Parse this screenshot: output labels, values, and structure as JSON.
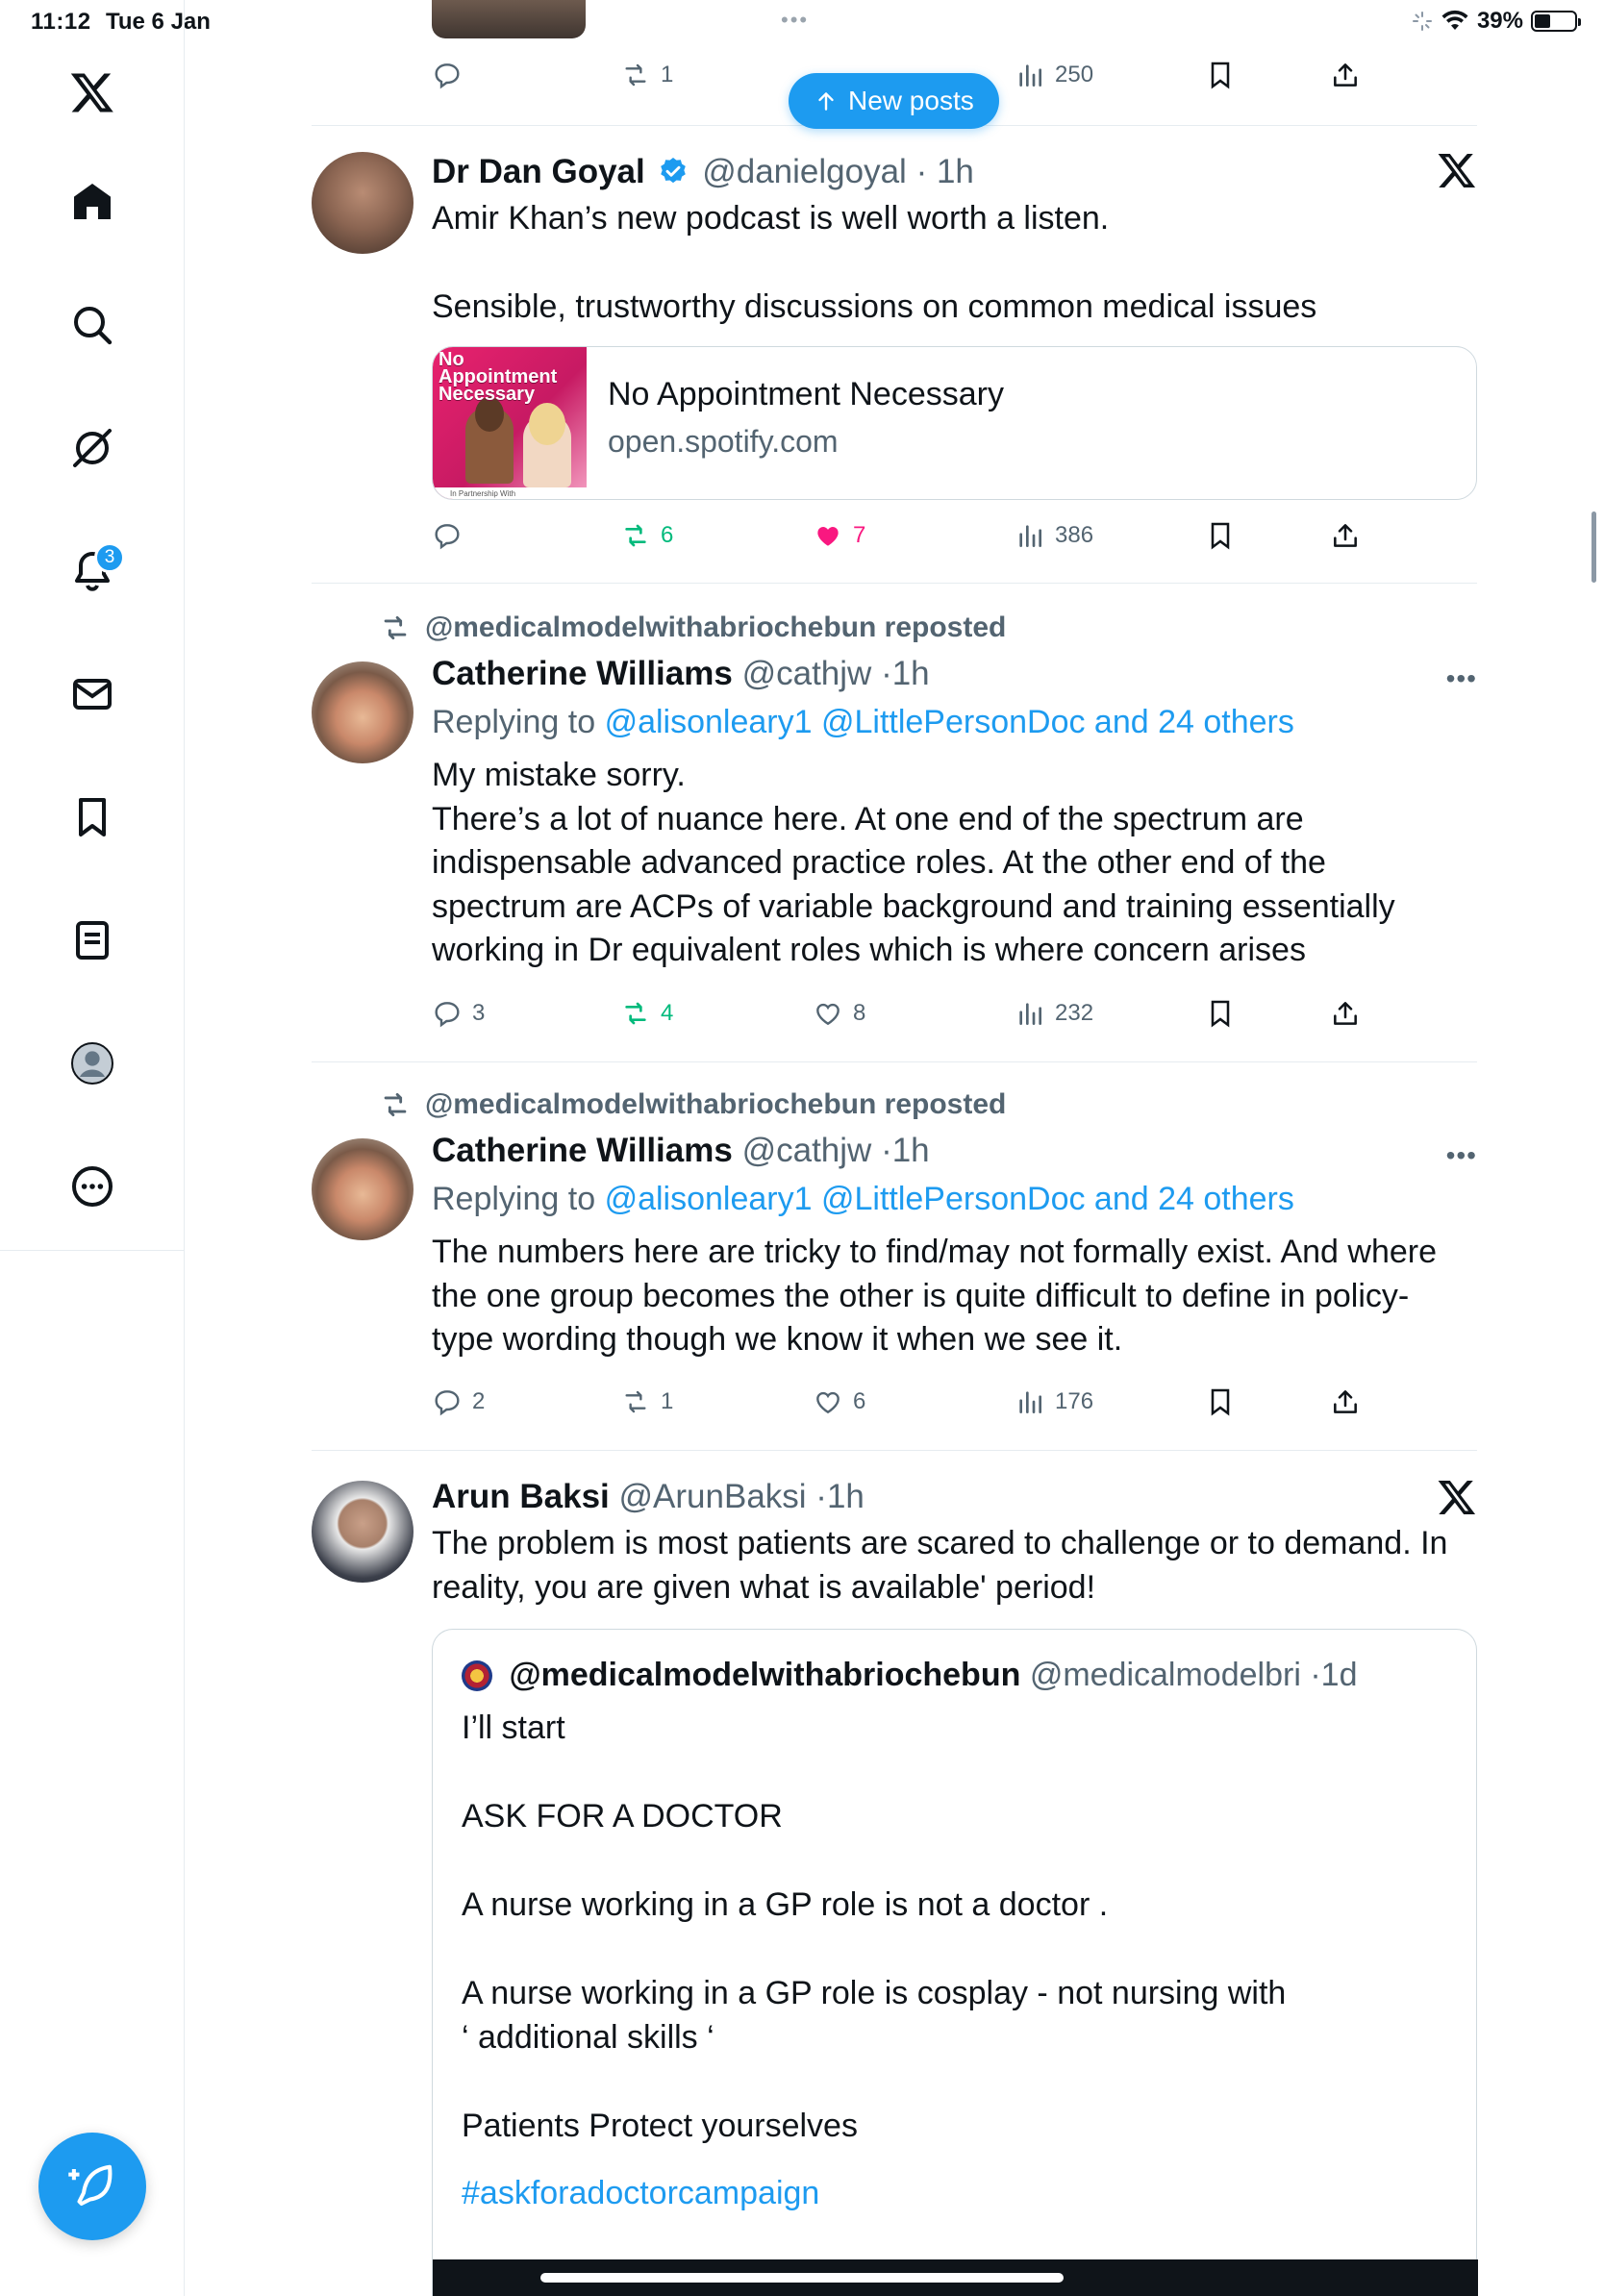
{
  "status_bar": {
    "time": "11:12",
    "date": "Tue 6 Jan",
    "battery": "39%",
    "battery_level": 0.39
  },
  "sidebar": {
    "items": [
      {
        "name": "home",
        "icon": "home-icon"
      },
      {
        "name": "explore",
        "icon": "search-icon"
      },
      {
        "name": "grok",
        "icon": "grok-icon"
      },
      {
        "name": "notifications",
        "icon": "bell-icon",
        "badge": "3"
      },
      {
        "name": "messages",
        "icon": "envelope-icon"
      },
      {
        "name": "bookmarks",
        "icon": "bookmark-icon"
      },
      {
        "name": "lists",
        "icon": "list-icon"
      },
      {
        "name": "profile",
        "icon": "profile-icon"
      },
      {
        "name": "more",
        "icon": "more-icon"
      }
    ]
  },
  "new_posts_label": "New posts",
  "top_stub": {
    "retweets": "1",
    "views": "250"
  },
  "tweets": [
    {
      "name": "Dr Dan Goyal",
      "handle": "@danielgoyal",
      "time": "1h",
      "text": "Amir Khan’s new podcast is well worth a listen.\n\nSensible, trustworthy discussions on common medical issues",
      "card": {
        "title": "No Appointment Necessary",
        "domain": "open.spotify.com",
        "thumb_title": "No Appointment Necessary",
        "thumb_footer": "In Partnership With"
      },
      "replies": "",
      "retweets": "6",
      "likes": "7",
      "views": "386"
    },
    {
      "reposted_by": "@medicalmodelwithabriochebun reposted",
      "name": "Catherine Williams",
      "handle": "@cathjw",
      "time": "1h",
      "replying_prefix": "Replying to",
      "replying_to": "@alisonleary1 @LittlePersonDoc and 24 others",
      "text": "My mistake sorry.\nThere’s a lot of nuance here. At one end of the spectrum are\nindispensable advanced practice roles. At the other end of the\nspectrum are ACPs of variable background and training essentially\nworking in Dr equivalent roles which is where concern arises",
      "replies": "3",
      "retweets": "4",
      "likes": "8",
      "views": "232"
    },
    {
      "reposted_by": "@medicalmodelwithabriochebun reposted",
      "name": "Catherine Williams",
      "handle": "@cathjw",
      "time": "1h",
      "replying_prefix": "Replying to",
      "replying_to": "@alisonleary1 @LittlePersonDoc and 24 others",
      "text": "The numbers here are tricky to find/may not formally exist. And where\nthe one group becomes the other is quite difficult to define in policy-\ntype wording though we know it when we see it.",
      "replies": "2",
      "retweets": "1",
      "likes": "6",
      "views": "176"
    },
    {
      "name": "Arun Baksi",
      "handle": "@ArunBaksi",
      "time": "1h",
      "text": "The problem is most patients are scared to challenge or to demand. In\nreality, you are given what is available' period!",
      "quote": {
        "name": "@medicalmodelwithabriochebun",
        "handle": "@medicalmodelbri",
        "time": "1d",
        "text": "I’ll start\n\nASK FOR A DOCTOR\n\nA nurse working in a GP role is not a doctor .\n\nA nurse working in a GP role is cosplay - not nursing with\n‘ additional skills ‘\n\nPatients Protect yourselves",
        "hashtag": "#askforadoctorcampaign"
      }
    }
  ],
  "colors": {
    "accent": "#1d9bf0",
    "retweet_green": "#00ba7c",
    "like_pink": "#f91880",
    "muted": "#536471",
    "border": "#e6ecf0"
  }
}
